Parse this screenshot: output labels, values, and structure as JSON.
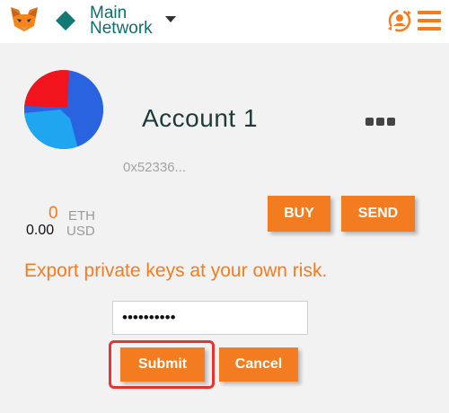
{
  "header": {
    "network_line1": "Main",
    "network_line2": "Network",
    "icons": {
      "logo": "metamask-fox-icon",
      "network": "network-diamond-icon",
      "dropdown": "chevron-down-icon",
      "switch_account": "switch-account-icon",
      "menu": "hamburger-menu-icon"
    }
  },
  "account": {
    "name": "Account 1",
    "address": "0x52336...",
    "eth_amount": "0",
    "eth_unit": "ETH",
    "usd_amount": "0.00",
    "usd_unit": "USD",
    "more_icon": "more-options-icon"
  },
  "actions": {
    "buy_label": "BUY",
    "send_label": "SEND"
  },
  "export": {
    "warning": "Export private keys at your own risk.",
    "password_value": "••••••••••",
    "submit_label": "Submit",
    "cancel_label": "Cancel"
  },
  "colors": {
    "accent": "#f47c20",
    "network_teal": "#0f6e6b",
    "highlight_red": "#e8332e"
  }
}
